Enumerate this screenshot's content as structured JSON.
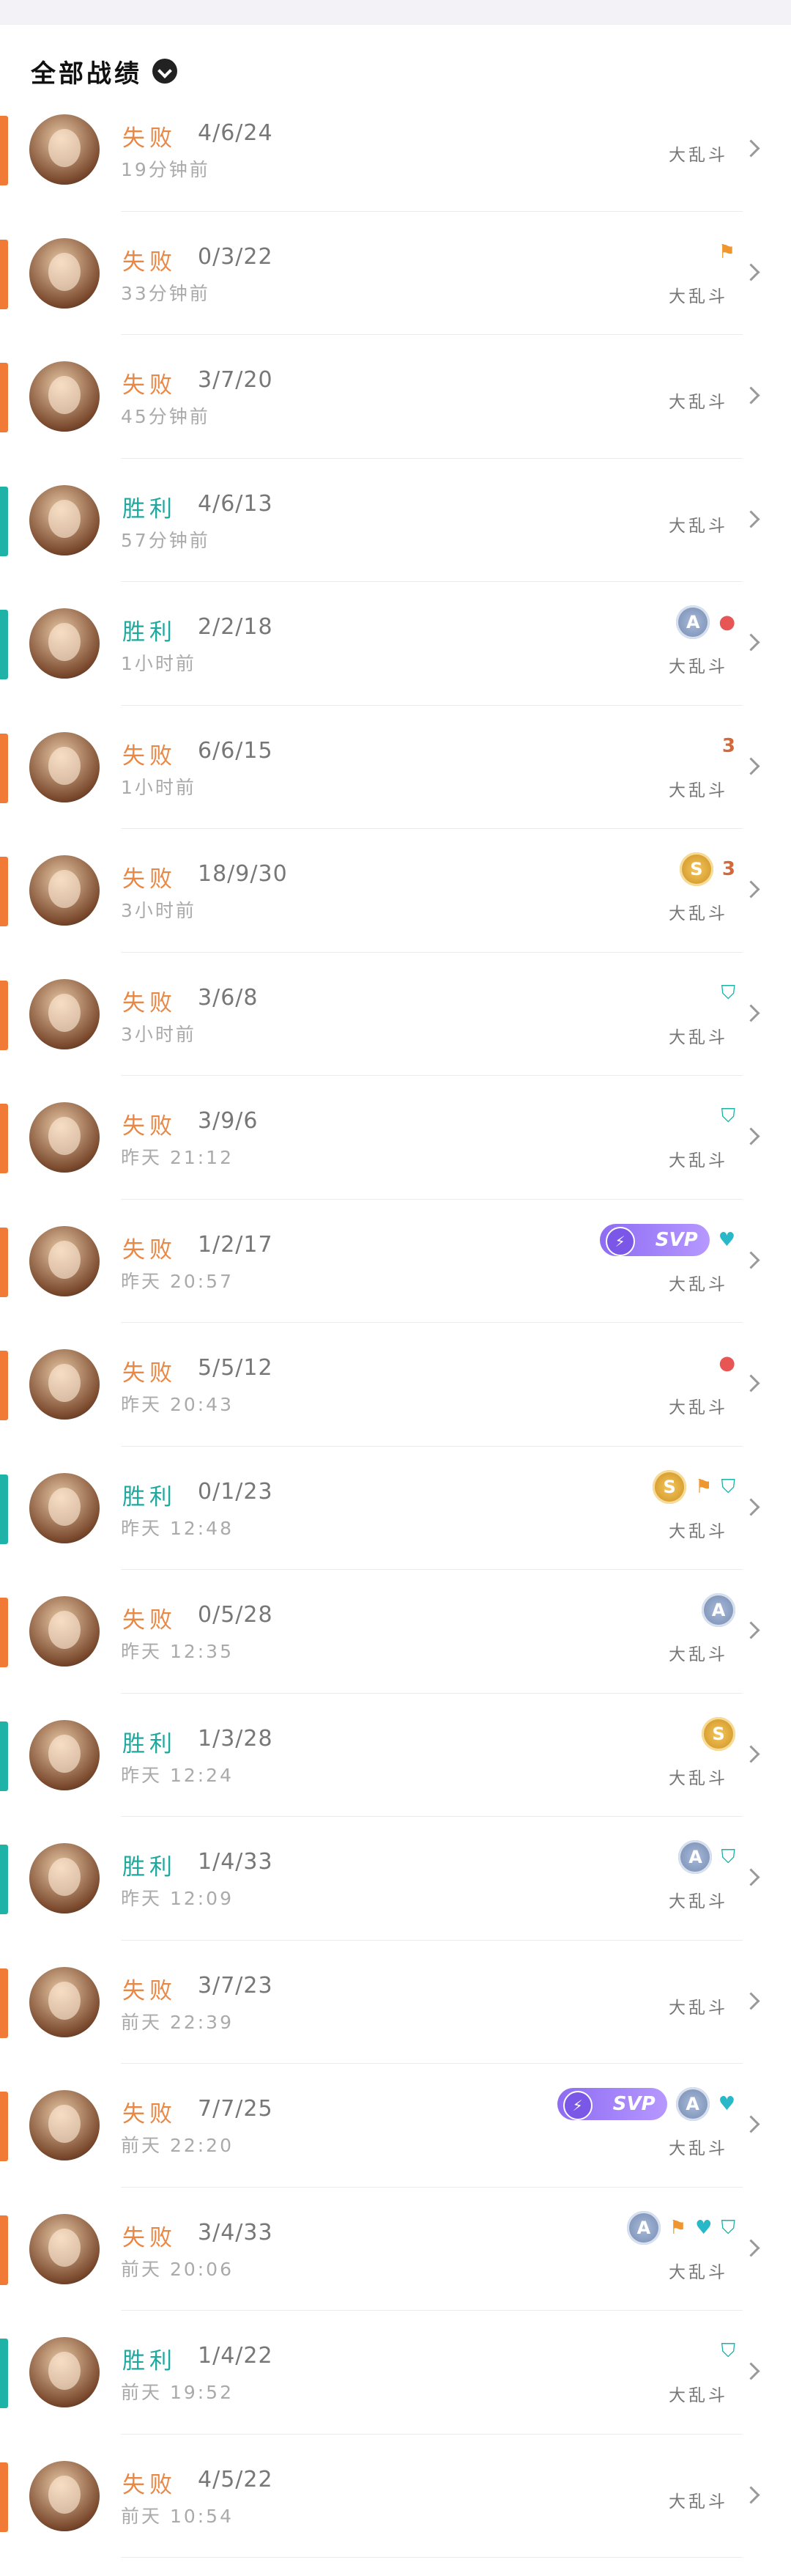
{
  "header": {
    "title": "全部战绩"
  },
  "matches": [
    {
      "result": "失败",
      "kda": "4/6/24",
      "time": "19分钟前",
      "mode": "大乱斗",
      "outcome": "lose",
      "badges": []
    },
    {
      "result": "失败",
      "kda": "0/3/22",
      "time": "33分钟前",
      "mode": "大乱斗",
      "outcome": "lose",
      "badges": [
        "flag-icon"
      ]
    },
    {
      "result": "失败",
      "kda": "3/7/20",
      "time": "45分钟前",
      "mode": "大乱斗",
      "outcome": "lose",
      "badges": []
    },
    {
      "result": "胜利",
      "kda": "4/6/13",
      "time": "57分钟前",
      "mode": "大乱斗",
      "outcome": "win",
      "badges": []
    },
    {
      "result": "胜利",
      "kda": "2/2/18",
      "time": "1小时前",
      "mode": "大乱斗",
      "outcome": "win",
      "badges": [
        "medal-A-icon",
        "first-blood-icon"
      ]
    },
    {
      "result": "失败",
      "kda": "6/6/15",
      "time": "1小时前",
      "mode": "大乱斗",
      "outcome": "lose",
      "badges": [
        "triple-kill-icon"
      ]
    },
    {
      "result": "失败",
      "kda": "18/9/30",
      "time": "3小时前",
      "mode": "大乱斗",
      "outcome": "lose",
      "badges": [
        "medal-S-icon",
        "triple-kill-icon"
      ]
    },
    {
      "result": "失败",
      "kda": "3/6/8",
      "time": "3小时前",
      "mode": "大乱斗",
      "outcome": "lose",
      "badges": [
        "shield-icon"
      ]
    },
    {
      "result": "失败",
      "kda": "3/9/6",
      "time": "昨天 21:12",
      "mode": "大乱斗",
      "outcome": "lose",
      "badges": [
        "shield-icon"
      ]
    },
    {
      "result": "失败",
      "kda": "1/2/17",
      "time": "昨天 20:57",
      "mode": "大乱斗",
      "outcome": "lose",
      "badges": [
        "svp-badge",
        "heal-icon"
      ]
    },
    {
      "result": "失败",
      "kda": "5/5/12",
      "time": "昨天 20:43",
      "mode": "大乱斗",
      "outcome": "lose",
      "badges": [
        "first-blood-icon"
      ]
    },
    {
      "result": "胜利",
      "kda": "0/1/23",
      "time": "昨天 12:48",
      "mode": "大乱斗",
      "outcome": "win",
      "badges": [
        "medal-S-icon",
        "flag-icon",
        "shield-icon"
      ]
    },
    {
      "result": "失败",
      "kda": "0/5/28",
      "time": "昨天 12:35",
      "mode": "大乱斗",
      "outcome": "lose",
      "badges": [
        "medal-A-icon"
      ]
    },
    {
      "result": "胜利",
      "kda": "1/3/28",
      "time": "昨天 12:24",
      "mode": "大乱斗",
      "outcome": "win",
      "badges": [
        "medal-S-icon"
      ]
    },
    {
      "result": "胜利",
      "kda": "1/4/33",
      "time": "昨天 12:09",
      "mode": "大乱斗",
      "outcome": "win",
      "badges": [
        "medal-A-icon",
        "shield-icon"
      ]
    },
    {
      "result": "失败",
      "kda": "3/7/23",
      "time": "前天 22:39",
      "mode": "大乱斗",
      "outcome": "lose",
      "badges": []
    },
    {
      "result": "失败",
      "kda": "7/7/25",
      "time": "前天 22:20",
      "mode": "大乱斗",
      "outcome": "lose",
      "badges": [
        "svp-badge",
        "medal-A-icon",
        "heal-icon"
      ]
    },
    {
      "result": "失败",
      "kda": "3/4/33",
      "time": "前天 20:06",
      "mode": "大乱斗",
      "outcome": "lose",
      "badges": [
        "medal-A-icon",
        "flag-icon",
        "heal-icon",
        "shield-icon"
      ]
    },
    {
      "result": "胜利",
      "kda": "1/4/22",
      "time": "前天 19:52",
      "mode": "大乱斗",
      "outcome": "win",
      "badges": [
        "shield-icon"
      ]
    },
    {
      "result": "失败",
      "kda": "4/5/22",
      "time": "前天 10:54",
      "mode": "大乱斗",
      "outcome": "lose",
      "badges": []
    }
  ],
  "badge_text": {
    "svp": "SVP",
    "medal_A": "A",
    "medal_S": "S",
    "triple": "3"
  },
  "colors": {
    "win": "#1fb2a6",
    "lose": "#f07a36",
    "svp": "#8e6cf3"
  }
}
